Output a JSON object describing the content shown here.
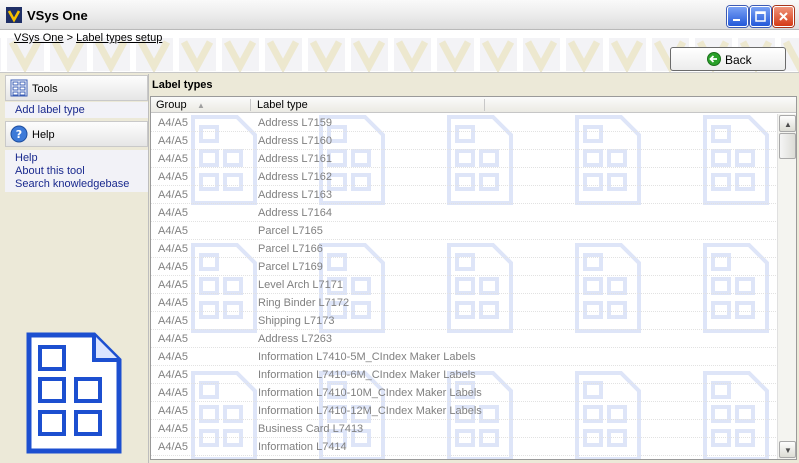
{
  "window": {
    "title": "VSys One",
    "min_icon": "minimize-icon",
    "max_icon": "maximize-icon",
    "close_icon": "close-icon"
  },
  "breadcrumb": {
    "home": "VSys One",
    "separator": ">",
    "current": "Label types setup"
  },
  "header": {
    "back_label": "Back"
  },
  "sidebar": {
    "tools_title": "Tools",
    "tools_links": [
      "Add label type"
    ],
    "help_title": "Help",
    "help_links": [
      "Help",
      "About this tool",
      "Search knowledgebase"
    ]
  },
  "main": {
    "title": "Label types",
    "columns": [
      "Group",
      "Label type"
    ],
    "rows": [
      [
        "A4/A5",
        "Address L7159"
      ],
      [
        "A4/A5",
        "Address L7160"
      ],
      [
        "A4/A5",
        "Address L7161"
      ],
      [
        "A4/A5",
        "Address L7162"
      ],
      [
        "A4/A5",
        "Address L7163"
      ],
      [
        "A4/A5",
        "Address L7164"
      ],
      [
        "A4/A5",
        "Parcel L7165"
      ],
      [
        "A4/A5",
        "Parcel L7166"
      ],
      [
        "A4/A5",
        "Parcel L7169"
      ],
      [
        "A4/A5",
        "Level Arch L7171"
      ],
      [
        "A4/A5",
        "Ring Binder L7172"
      ],
      [
        "A4/A5",
        "Shipping L7173"
      ],
      [
        "A4/A5",
        "Address L7263"
      ],
      [
        "A4/A5",
        "Information L7410-5M_CIndex Maker Labels"
      ],
      [
        "A4/A5",
        "Information L7410-6M_CIndex Maker Labels"
      ],
      [
        "A4/A5",
        "Information L7410-10M_CIndex Maker Labels"
      ],
      [
        "A4/A5",
        "Information L7410-12M_CIndex Maker Labels"
      ],
      [
        "A4/A5",
        "Business Card L7413"
      ],
      [
        "A4/A5",
        "Information L7414"
      ]
    ]
  },
  "colors": {
    "link": "#1a2a8e",
    "accent": "#2459d9",
    "row_text": "#808080"
  }
}
